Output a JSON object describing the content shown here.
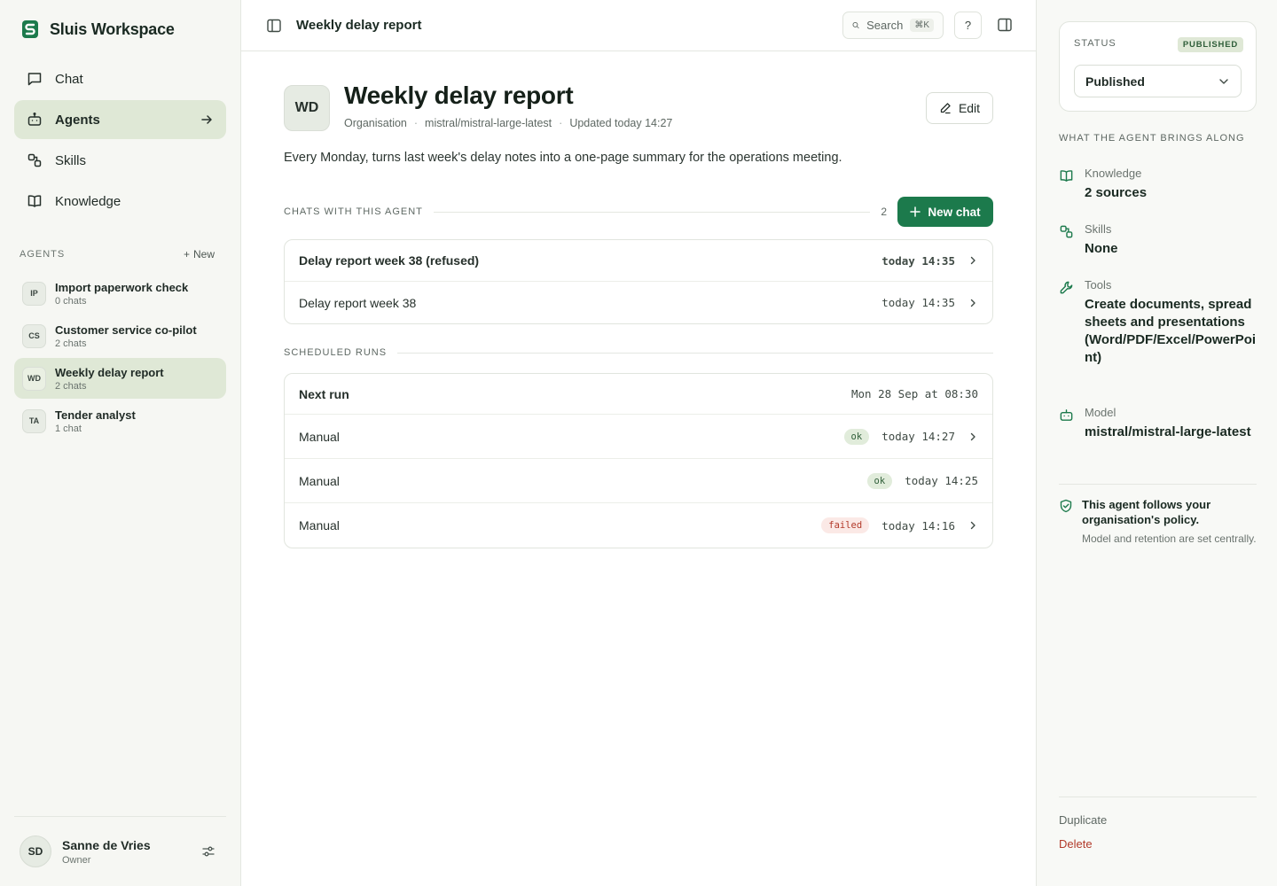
{
  "brand": {
    "name": "Sluis Workspace",
    "logo_color": "#1c7a4c"
  },
  "nav": [
    {
      "label": "Chat",
      "icon": "chat-icon",
      "active": false
    },
    {
      "label": "Agents",
      "icon": "robot-icon",
      "active": true
    },
    {
      "label": "Skills",
      "icon": "skills-icon",
      "active": false
    },
    {
      "label": "Knowledge",
      "icon": "book-icon",
      "active": false
    }
  ],
  "agents_section": {
    "label": "AGENTS",
    "new_label": "New"
  },
  "agents": [
    {
      "initials": "IP",
      "name": "Import paperwork check",
      "sub": "0 chats",
      "active": false
    },
    {
      "initials": "CS",
      "name": "Customer service co-pilot",
      "sub": "2 chats",
      "active": false
    },
    {
      "initials": "WD",
      "name": "Weekly delay report",
      "sub": "2 chats",
      "active": true
    },
    {
      "initials": "TA",
      "name": "Tender analyst",
      "sub": "1 chat",
      "active": false
    }
  ],
  "user": {
    "initials": "SD",
    "name": "Sanne de Vries",
    "role": "Owner"
  },
  "topbar": {
    "title": "Weekly delay report",
    "search_label": "Search",
    "search_kbd": "⌘K",
    "help_label": "?"
  },
  "agent": {
    "initials": "WD",
    "title": "Weekly delay report",
    "meta": [
      "Organisation",
      "mistral/mistral-large-latest",
      "Updated today 14:27"
    ],
    "edit_label": "Edit",
    "description": "Every Monday, turns last week's delay notes into a one-page summary for the operations meeting."
  },
  "chats": {
    "label": "CHATS WITH THIS AGENT",
    "count": "2",
    "new_chat_label": "New chat",
    "items": [
      {
        "title": "Delay report week 38 (refused)",
        "time": "today 14:35",
        "bold": true
      },
      {
        "title": "Delay report week 38",
        "time": "today 14:35",
        "bold": false
      }
    ]
  },
  "runs": {
    "label": "SCHEDULED RUNS",
    "next": {
      "title": "Next run",
      "time": "Mon 28 Sep at 08:30"
    },
    "items": [
      {
        "title": "Manual",
        "status": "ok",
        "time": "today 14:27",
        "chevron": true
      },
      {
        "title": "Manual",
        "status": "ok",
        "time": "today 14:25",
        "chevron": false
      },
      {
        "title": "Manual",
        "status": "failed",
        "time": "today 14:16",
        "chevron": true
      }
    ]
  },
  "panel": {
    "status_label": "STATUS",
    "status_badge": "PUBLISHED",
    "status_value": "Published",
    "brings_label": "WHAT THE AGENT BRINGS ALONG",
    "props": [
      {
        "label": "Knowledge",
        "value": "2 sources",
        "icon": "book-icon"
      },
      {
        "label": "Skills",
        "value": "None",
        "icon": "skills-icon"
      },
      {
        "label": "Tools",
        "value": "Create documents, spreadsheets and presentations (Word/PDF/Excel/PowerPoint)",
        "icon": "wrench-icon"
      },
      {
        "label": "Model",
        "value": "mistral/mistral-large-latest",
        "icon": "robot-icon"
      }
    ],
    "policy_title": "This agent follows your organisation's policy.",
    "policy_sub": "Model and retention are set centrally.",
    "duplicate_label": "Duplicate",
    "delete_label": "Delete"
  },
  "colors": {
    "accent": "#1c7a4c",
    "active_bg": "#dfe8d6",
    "danger": "#b23a2a"
  }
}
